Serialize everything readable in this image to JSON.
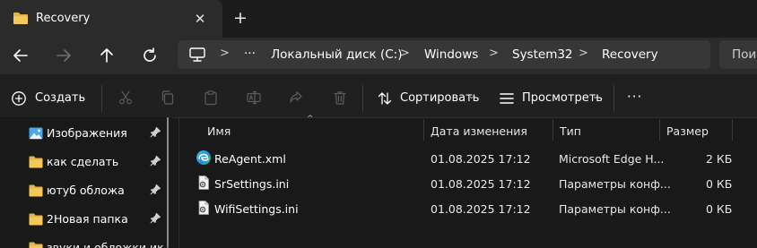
{
  "tab": {
    "title": "Recovery",
    "close": "✕",
    "new_tab": "+"
  },
  "breadcrumb": {
    "overflow": "···",
    "sep": ">",
    "items": [
      "Локальный диск (C:)",
      "Windows",
      "System32",
      "Recovery"
    ]
  },
  "search": {
    "placeholder": "Пои"
  },
  "command_bar": {
    "create": "Создать",
    "sort": "Сортировать",
    "view": "Просмотреть",
    "more": "···",
    "caret": "⌄"
  },
  "nav_pane": {
    "items": [
      {
        "label": "Изображения",
        "icon": "pictures-icon",
        "pinned": true
      },
      {
        "label": "как сделать",
        "icon": "folder-icon",
        "pinned": true
      },
      {
        "label": "ютуб обложа",
        "icon": "folder-icon",
        "pinned": true
      },
      {
        "label": "2Новая папка",
        "icon": "folder-icon",
        "pinned": true
      },
      {
        "label": "звуки и обложки ик",
        "icon": "folder-icon",
        "pinned": false
      }
    ]
  },
  "file_list": {
    "columns": {
      "name": "Имя",
      "date": "Дата изменения",
      "type": "Тип",
      "size": "Размер"
    },
    "sort_arrow": "^",
    "rows": [
      {
        "name": "ReAgent.xml",
        "date": "01.08.2025 17:12",
        "type": "Microsoft Edge H...",
        "size": "2 КБ",
        "icon": "edge-xml-icon"
      },
      {
        "name": "SrSettings.ini",
        "date": "01.08.2025 17:12",
        "type": "Параметры конф...",
        "size": "0 КБ",
        "icon": "settings-file-icon"
      },
      {
        "name": "WifiSettings.ini",
        "date": "01.08.2025 17:12",
        "type": "Параметры конф...",
        "size": "0 КБ",
        "icon": "settings-file-icon"
      }
    ]
  },
  "colors": {
    "folder": "#e8b44a",
    "accent": "#4cc2ff",
    "background": "#191919",
    "titlebar": "#1c1c1c",
    "tab_active": "#2b2b2b"
  }
}
